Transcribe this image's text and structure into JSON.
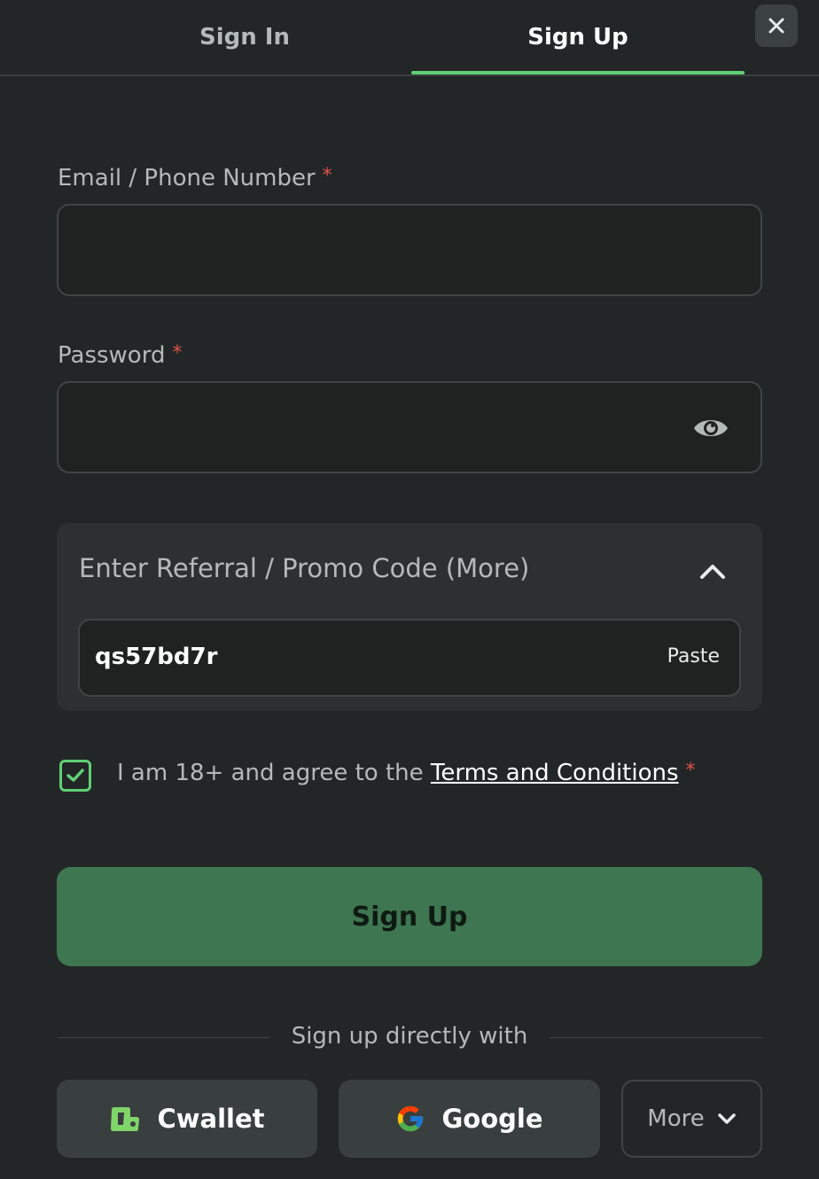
{
  "tabs": {
    "sign_in": "Sign In",
    "sign_up": "Sign Up",
    "active": "sign_up",
    "close_icon": "close-icon"
  },
  "form": {
    "email_label": "Email / Phone Number",
    "email_value": "",
    "password_label": "Password",
    "password_value": "",
    "required_mark": "*"
  },
  "referral": {
    "title": "Enter Referral / Promo Code (More)",
    "code": "qs57bd7r",
    "paste_label": "Paste"
  },
  "agree": {
    "text": "I am 18+ and agree to the",
    "link": "Terms and Conditions",
    "checked": true
  },
  "submit": {
    "label": "Sign Up"
  },
  "social": {
    "divider_text": "Sign up directly with",
    "cwallet": "Cwallet",
    "google": "Google",
    "more": "More"
  },
  "colors": {
    "background": "#232626",
    "accent": "#5fd076",
    "button": "#3e7651",
    "required": "#e0524a"
  }
}
